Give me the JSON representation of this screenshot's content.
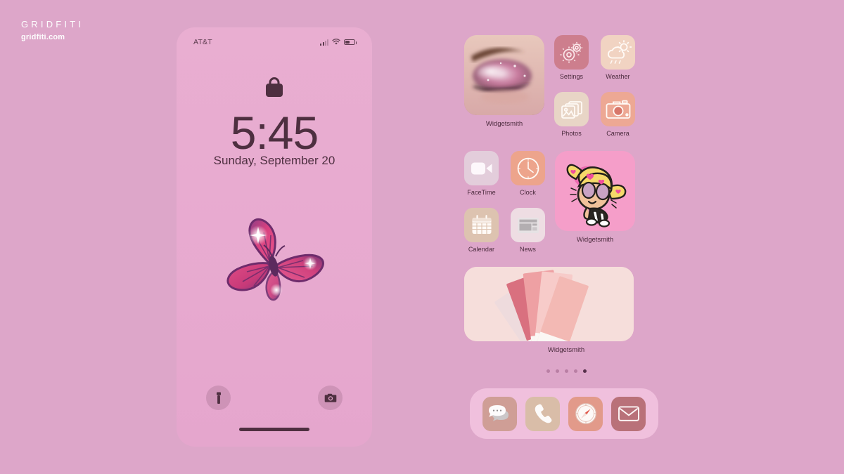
{
  "brand": {
    "name": "GRIDFITI",
    "url": "gridfiti.com"
  },
  "lock_screen": {
    "status": {
      "carrier": "AT&T",
      "signal_icon": "cellular-signal-icon",
      "wifi_icon": "wifi-icon",
      "battery_icon": "battery-icon"
    },
    "lock_icon": "lock-icon",
    "time": "5:45",
    "date": "Sunday, September 20",
    "wallpaper": "pink-butterfly-wallpaper",
    "flashlight_icon": "flashlight-icon",
    "camera_icon": "camera-icon",
    "home_indicator": "home-indicator"
  },
  "home_screen": {
    "widgets": [
      {
        "name": "Widgetsmith",
        "kind": "photo-eye-makeup-widget"
      },
      {
        "name": "Widgetsmith",
        "kind": "powerpuff-bubbles-widget"
      },
      {
        "name": "Widgetsmith",
        "kind": "pantone-swatch-fan-widget"
      }
    ],
    "apps": [
      {
        "label": "Settings",
        "icon": "settings-gears-icon",
        "bg": "#cd7e8d",
        "fg": "#ffffff"
      },
      {
        "label": "Weather",
        "icon": "weather-cloud-sun-icon",
        "bg": "#f1d3c2",
        "fg": "#ffffff"
      },
      {
        "label": "Photos",
        "icon": "photos-stack-icon",
        "bg": "#e8d5c6",
        "fg": "#ffffff"
      },
      {
        "label": "Camera",
        "icon": "camera-icon",
        "bg": "#eda894",
        "fg": "#ffffff"
      },
      {
        "label": "FaceTime",
        "icon": "facetime-video-icon",
        "bg": "#e3cddb",
        "fg": "#ffffff"
      },
      {
        "label": "Clock",
        "icon": "clock-face-icon",
        "bg": "#eda48c",
        "fg": "#ffffff"
      },
      {
        "label": "Calendar",
        "icon": "calendar-grid-icon",
        "bg": "#ddc3b0",
        "fg": "#ffffff"
      },
      {
        "label": "News",
        "icon": "news-paper-icon",
        "bg": "#eedde3",
        "fg": "#a8a3a6"
      }
    ],
    "page_dots": {
      "count": 5,
      "active_index": 5
    },
    "dock": [
      {
        "label": "Messages",
        "icon": "messages-bubble-icon",
        "bg": "#cf9e96"
      },
      {
        "label": "Phone",
        "icon": "phone-handset-icon",
        "bg": "#d9bda8"
      },
      {
        "label": "Safari",
        "icon": "safari-compass-icon",
        "bg": "#e29a8a"
      },
      {
        "label": "Mail",
        "icon": "mail-envelope-icon",
        "bg": "#b97179"
      }
    ]
  },
  "colors": {
    "page_background": "#dda6c9",
    "phone_screen": "#e8acd0",
    "text_dark": "#4e2f40",
    "dock_background": "#ffd6ec"
  }
}
